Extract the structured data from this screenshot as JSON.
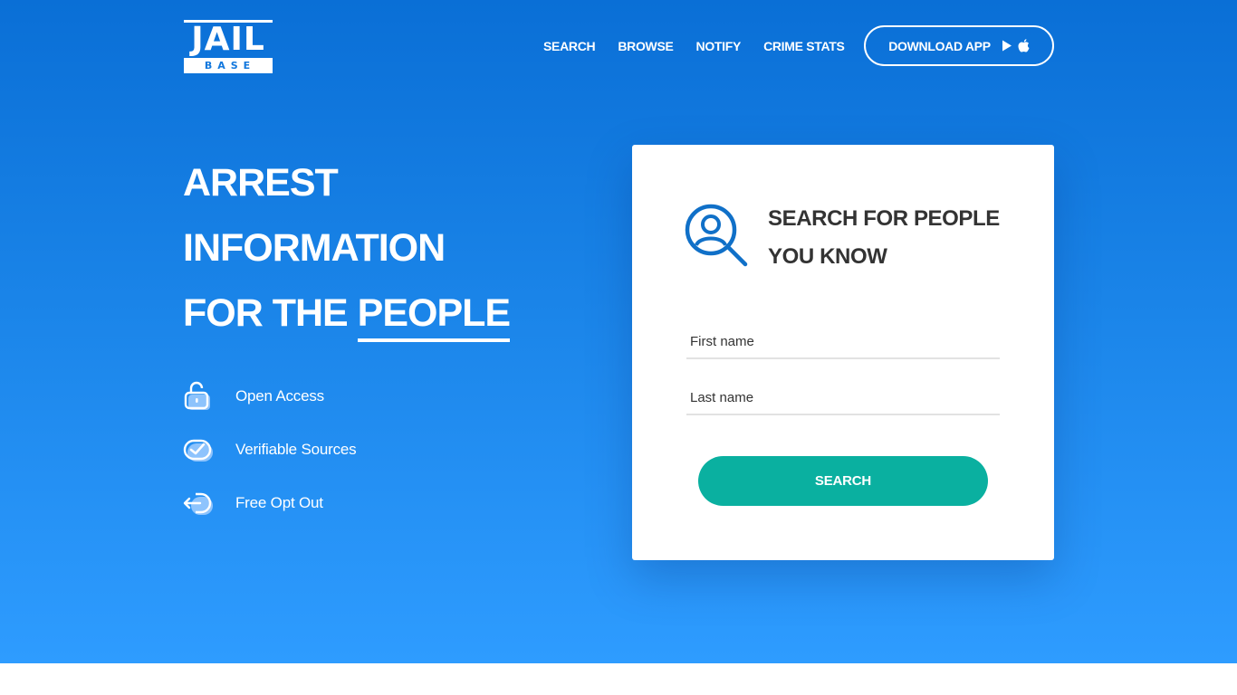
{
  "logo": {
    "top": "JAIL",
    "bottom": "BASE"
  },
  "nav": {
    "links": [
      "SEARCH",
      "BROWSE",
      "NOTIFY",
      "CRIME STATS"
    ],
    "download_label": "DOWNLOAD APP",
    "download_icons": [
      "play-store-icon",
      "apple-icon"
    ]
  },
  "hero": {
    "headline": [
      "ARREST",
      "INFORMATION",
      "FOR THE "
    ],
    "headline_emphasis": "PEOPLE",
    "features": [
      {
        "icon": "unlock-icon",
        "label": "Open Access"
      },
      {
        "icon": "check-circle-icon",
        "label": "Verifiable Sources"
      },
      {
        "icon": "opt-out-icon",
        "label": "Free Opt Out"
      }
    ]
  },
  "search_card": {
    "icon": "person-search-icon",
    "title": "SEARCH FOR PEOPLE YOU KNOW",
    "first_name_placeholder": "First name",
    "last_name_placeholder": "Last name",
    "button_label": "SEARCH"
  },
  "colors": {
    "hero_top": "#0a6fd6",
    "hero_bottom": "#2e9cff",
    "accent_teal": "#0ab0a0",
    "icon_blue": "#1070c8"
  }
}
